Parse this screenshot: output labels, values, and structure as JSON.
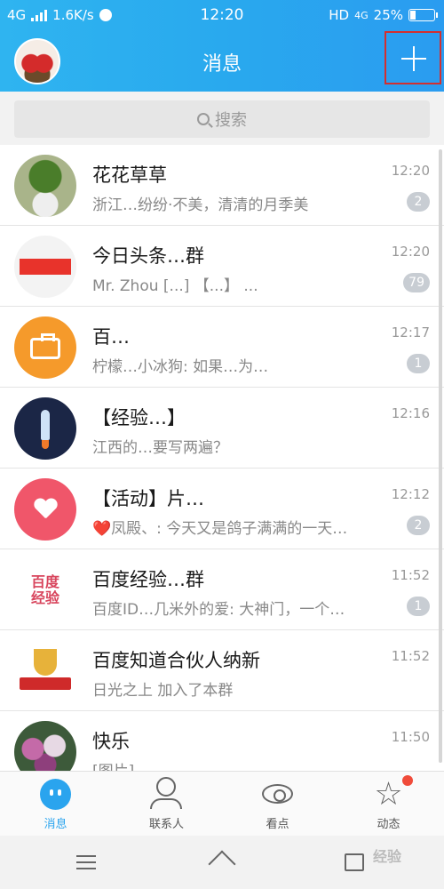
{
  "status_bar": {
    "network": "4G",
    "speed": "1.6K/s",
    "time": "12:20",
    "hd": "HD",
    "network2": "4G",
    "battery": "25%",
    "battery_level": 0.25
  },
  "header": {
    "title": "消息"
  },
  "search": {
    "placeholder": "搜索"
  },
  "conversations": [
    {
      "name": "花花草草",
      "message": "浙江…纷纷·不美，清清的月季美",
      "time": "12:20",
      "badge": "2"
    },
    {
      "name": "今日头条…群",
      "message": "Mr. Zhou [...] 【...】 ...",
      "time": "12:20",
      "badge": "79"
    },
    {
      "name": "百…",
      "message": "柠檬…小冰狗: 如果…为…",
      "time": "12:17",
      "badge": "1"
    },
    {
      "name": "【经验…】",
      "message": "江西的…要写两遍？",
      "time": "12:16",
      "badge": ""
    },
    {
      "name": "【活动】片…",
      "message": "❤️凤殿、: 今天又是鸽子满满的一天…",
      "time": "12:12",
      "badge": "2"
    },
    {
      "name": "百度经验…群",
      "message": "百度ID…几米外的爱: 大神门，一个…",
      "time": "11:52",
      "badge": "1"
    },
    {
      "name": "百度知道合伙人纳新",
      "message": "日光之上 加入了本群",
      "time": "11:52",
      "badge": ""
    },
    {
      "name": "快乐",
      "message": "[图片]",
      "time": "11:50",
      "badge": ""
    }
  ],
  "avatar_texts": {
    "baidu": "百度\n经验"
  },
  "tabs": [
    {
      "label": "消息",
      "icon": "message-icon"
    },
    {
      "label": "联系人",
      "icon": "contact-icon"
    },
    {
      "label": "看点",
      "icon": "eye-icon"
    },
    {
      "label": "动态",
      "icon": "star-icon"
    }
  ],
  "watermark": "经验",
  "colors": {
    "accent": "#2aa4ee",
    "header_start": "#2fb4f0",
    "header_end": "#2a9cf0",
    "badge": "#c8cdd3",
    "notify_dot": "#f04b3a",
    "highlight_border": "#d32f2f"
  }
}
